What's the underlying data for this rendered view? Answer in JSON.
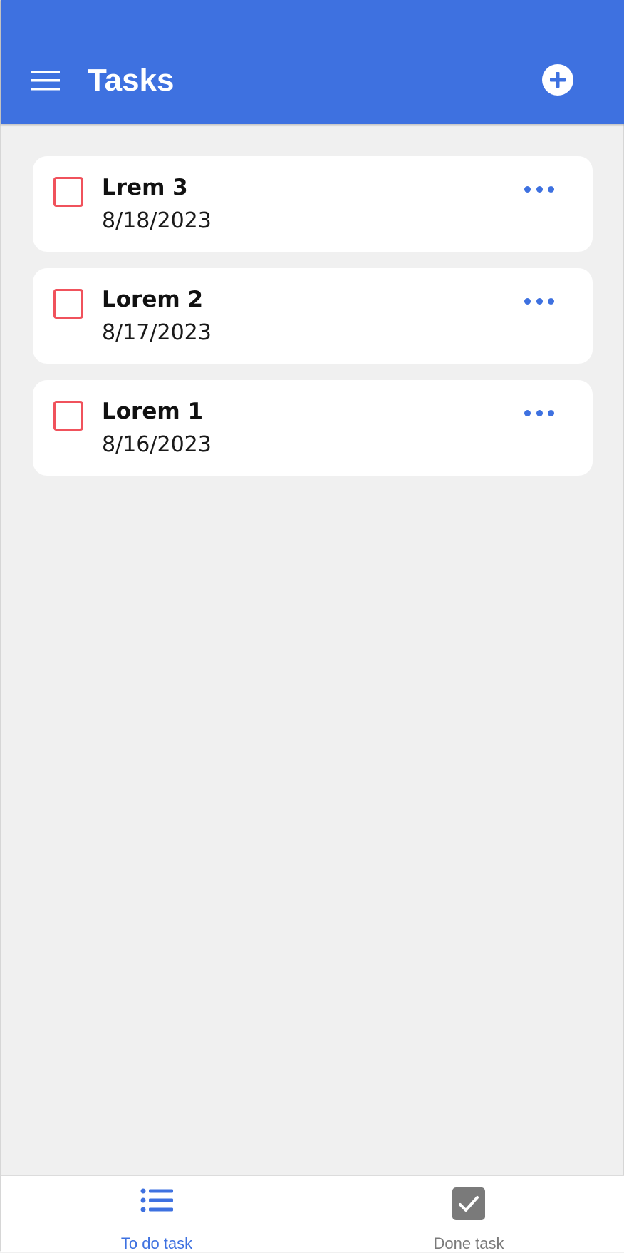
{
  "app_bar": {
    "title": "Tasks",
    "menu_icon": "hamburger-menu-icon",
    "add_icon": "plus-circle-icon",
    "background_color": "#3e71e0"
  },
  "tasks": [
    {
      "title": "Lrem 3",
      "date": "8/18/2023",
      "checked": false
    },
    {
      "title": "Lorem 2",
      "date": "8/17/2023",
      "checked": false
    },
    {
      "title": "Lorem 1",
      "date": "8/16/2023",
      "checked": false
    }
  ],
  "bottom_nav": {
    "items": [
      {
        "label": "To do task",
        "icon": "list-icon",
        "active": true,
        "color": "#3e71e0"
      },
      {
        "label": "Done task",
        "icon": "checkbox-checked-icon",
        "active": false,
        "color": "#7a7a7a"
      }
    ]
  },
  "colors": {
    "accent": "#3e71e0",
    "checkbox_border": "#f0525c",
    "background": "#f0f0f0"
  }
}
